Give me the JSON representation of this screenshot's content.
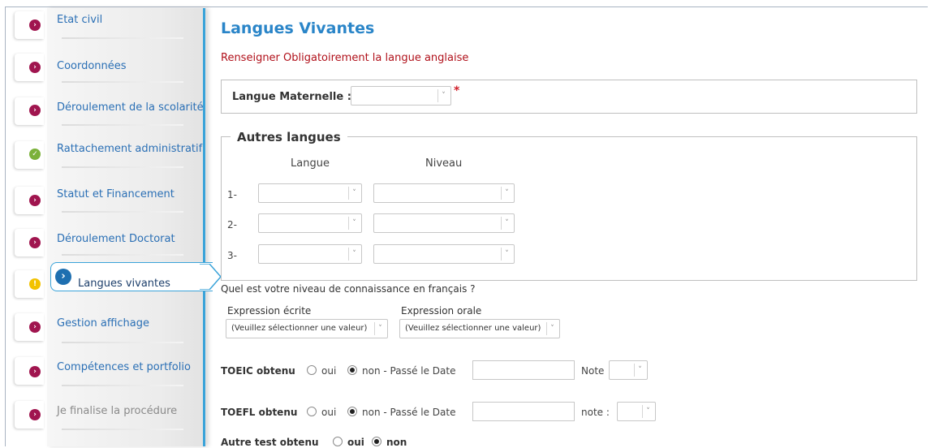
{
  "sidebar": {
    "items": [
      {
        "label": "Etat civil",
        "status": "pending"
      },
      {
        "label": "Coordonnées",
        "status": "pending"
      },
      {
        "label": "Déroulement de la scolarité",
        "status": "pending"
      },
      {
        "label": "Rattachement administratif",
        "status": "done"
      },
      {
        "label": "Statut et Financement",
        "status": "pending"
      },
      {
        "label": "Déroulement Doctorat",
        "status": "pending"
      },
      {
        "label": "Langues vivantes",
        "status": "current"
      },
      {
        "label": "Gestion affichage",
        "status": "pending"
      },
      {
        "label": "Compétences et portfolio",
        "status": "pending"
      },
      {
        "label": "Je finalise la procédure",
        "status": "disabled"
      }
    ]
  },
  "main": {
    "title": "Langues Vivantes",
    "notice": "Renseigner Obligatoirement la langue anglaise",
    "mother_tongue": {
      "label": "Langue Maternelle :",
      "value": "",
      "required_mark": "*"
    },
    "other_languages": {
      "legend": "Autres langues",
      "col_language": "Langue",
      "col_level": "Niveau",
      "rows": [
        {
          "index": "1-",
          "language": "",
          "level": ""
        },
        {
          "index": "2-",
          "language": "",
          "level": ""
        },
        {
          "index": "3-",
          "language": "",
          "level": ""
        }
      ]
    },
    "french": {
      "question": "Quel est votre niveau de connaissance en français ?",
      "written_label": "Expression écrite",
      "written_value": "(Veuillez sélectionner une valeur)",
      "oral_label": "Expression orale",
      "oral_value": "(Veuillez sélectionner une valeur)"
    },
    "toeic": {
      "label": "TOEIC obtenu",
      "oui": "oui",
      "non": "non - Passé le Date",
      "selected": "non",
      "date": "",
      "note_label": "Note",
      "note": ""
    },
    "toefl": {
      "label": "TOEFL obtenu",
      "oui": "oui",
      "non": "non - Passé le Date",
      "selected": "non",
      "date": "",
      "note_label": "note :",
      "note": ""
    },
    "other_test": {
      "label": "Autre test obtenu",
      "oui": "oui",
      "non": "non",
      "selected": "non"
    }
  },
  "colors": {
    "accent": "#2a85c8",
    "warning": "#b0101a",
    "bullet_pink": "#a0154f",
    "bullet_green": "#7bb13a",
    "bullet_yellow": "#f2c200"
  }
}
